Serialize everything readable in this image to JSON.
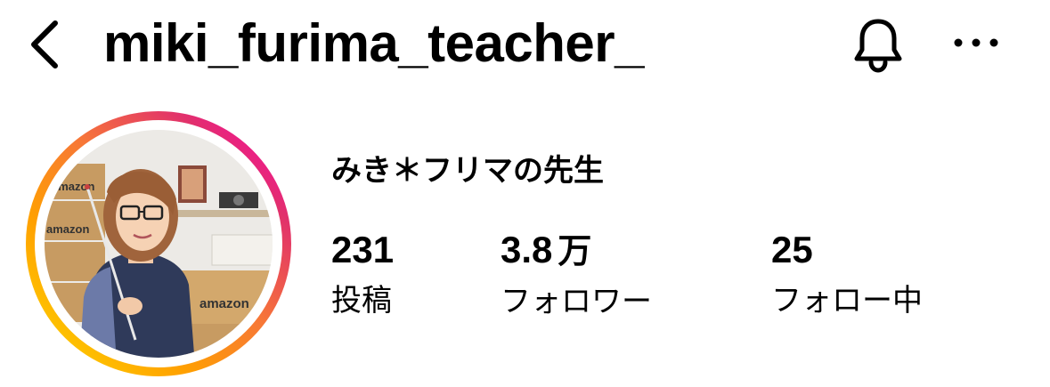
{
  "header": {
    "username": "miki_furima_teacher_",
    "back_icon": "chevron-left-icon",
    "bell_icon": "bell-icon",
    "more_icon": "more-horizontal-icon"
  },
  "profile": {
    "display_name": "みき＊フリマの先生",
    "avatar": {
      "ring_colors": [
        "#FEDA00",
        "#F77737",
        "#E1306C",
        "#C13584",
        "#FF00B4"
      ],
      "box_text": "amazon"
    },
    "stats": {
      "posts": {
        "value": "231",
        "label": "投稿"
      },
      "followers": {
        "value": "3.8",
        "unit": "万",
        "label": "フォロワー"
      },
      "following": {
        "value": "25",
        "label": "フォロー中"
      }
    }
  }
}
